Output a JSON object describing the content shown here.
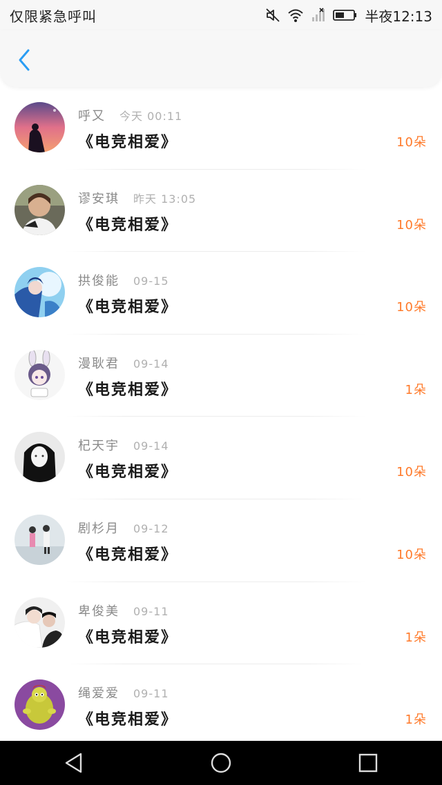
{
  "status_bar": {
    "left_text": "仅限紧急呼叫",
    "time": "半夜12:13",
    "icons": [
      "mute-icon",
      "wifi-icon",
      "signal-icon",
      "battery-icon"
    ]
  },
  "header": {
    "back_icon": "chevron-left-icon"
  },
  "colors": {
    "accent": "#2a9df4",
    "amount": "#ff7a2a"
  },
  "rows": [
    {
      "name": "呼又",
      "time": "今天 00:11",
      "gift": "《电竞相爱》",
      "amount": "10朵"
    },
    {
      "name": "谬安琪",
      "time": "昨天 13:05",
      "gift": "《电竞相爱》",
      "amount": "10朵"
    },
    {
      "name": "拱俊能",
      "time": "09-15",
      "gift": "《电竞相爱》",
      "amount": "10朵"
    },
    {
      "name": "漫耿君",
      "time": "09-14",
      "gift": "《电竞相爱》",
      "amount": "1朵"
    },
    {
      "name": "杞天宇",
      "time": "09-14",
      "gift": "《电竞相爱》",
      "amount": "10朵"
    },
    {
      "name": "剧杉月",
      "time": "09-12",
      "gift": "《电竞相爱》",
      "amount": "10朵"
    },
    {
      "name": "卑俊美",
      "time": "09-11",
      "gift": "《电竞相爱》",
      "amount": "1朵"
    },
    {
      "name": "绳爱爱",
      "time": "09-11",
      "gift": "《电竞相爱》",
      "amount": "1朵"
    }
  ],
  "nav": {
    "back_icon": "triangle-back-icon",
    "home_icon": "circle-home-icon",
    "recents_icon": "square-recents-icon"
  }
}
